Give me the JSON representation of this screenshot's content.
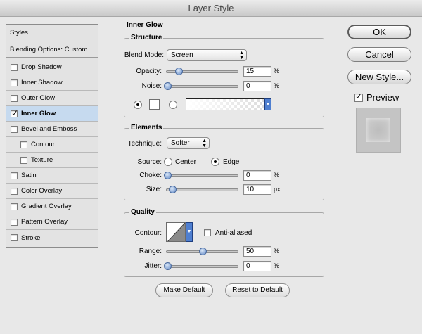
{
  "window": {
    "title": "Layer Style"
  },
  "sidebar": {
    "header": "Styles",
    "blending": "Blending Options: Custom",
    "items": [
      {
        "label": "Drop Shadow",
        "checked": false
      },
      {
        "label": "Inner Shadow",
        "checked": false
      },
      {
        "label": "Outer Glow",
        "checked": false
      },
      {
        "label": "Inner Glow",
        "checked": true
      },
      {
        "label": "Bevel and Emboss",
        "checked": false
      },
      {
        "label": "Contour",
        "checked": false
      },
      {
        "label": "Texture",
        "checked": false
      },
      {
        "label": "Satin",
        "checked": false
      },
      {
        "label": "Color Overlay",
        "checked": false
      },
      {
        "label": "Gradient Overlay",
        "checked": false
      },
      {
        "label": "Pattern Overlay",
        "checked": false
      },
      {
        "label": "Stroke",
        "checked": false
      }
    ]
  },
  "panel": {
    "title": "Inner Glow",
    "structure": {
      "title": "Structure",
      "blend_mode_label": "Blend Mode:",
      "blend_mode_value": "Screen",
      "opacity_label": "Opacity:",
      "opacity_value": "15",
      "opacity_pct": 15,
      "noise_label": "Noise:",
      "noise_value": "0",
      "noise_pct": 0,
      "pct_unit": "%"
    },
    "elements": {
      "title": "Elements",
      "technique_label": "Technique:",
      "technique_value": "Softer",
      "source_label": "Source:",
      "source_center": "Center",
      "source_edge": "Edge",
      "choke_label": "Choke:",
      "choke_value": "0",
      "choke_pct": 0,
      "size_label": "Size:",
      "size_value": "10",
      "size_unit": "px",
      "pct_unit": "%"
    },
    "quality": {
      "title": "Quality",
      "contour_label": "Contour:",
      "antialiased_label": "Anti-aliased",
      "range_label": "Range:",
      "range_value": "50",
      "range_pct": 50,
      "jitter_label": "Jitter:",
      "jitter_value": "0",
      "pct_unit": "%"
    },
    "make_default": "Make Default",
    "reset_default": "Reset to Default"
  },
  "actions": {
    "ok": "OK",
    "cancel": "Cancel",
    "new_style": "New Style...",
    "preview": "Preview",
    "preview_checked": true
  }
}
